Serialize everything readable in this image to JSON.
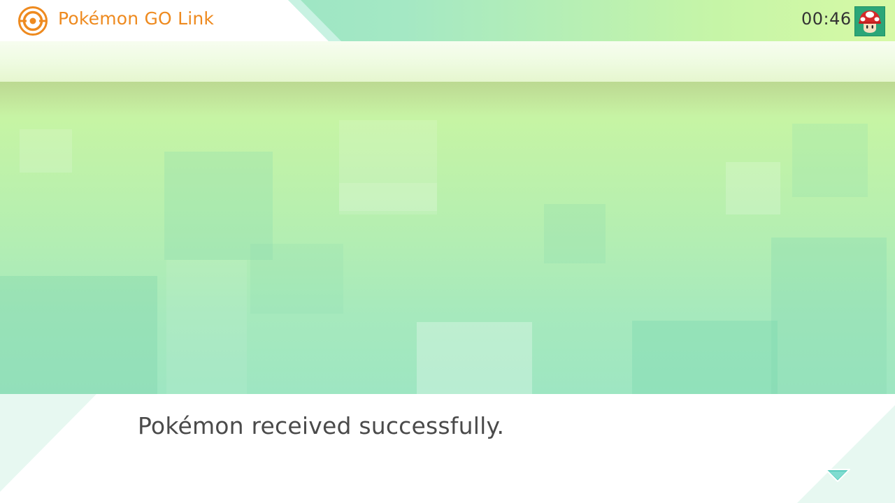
{
  "header": {
    "app_title": "Pokémon GO Link",
    "clock": "00:46",
    "app_icon": "poke-ball-ring-icon",
    "avatar_icon": "mushroom-icon"
  },
  "dialog": {
    "message": "Pokémon received successfully.",
    "advance_icon": "chevron-down-icon"
  },
  "colors": {
    "title_orange": "#ee8a1f",
    "scene_green": "#b6efb0",
    "advance_teal": "#5ccdbf",
    "avatar_green": "#2ba678"
  }
}
